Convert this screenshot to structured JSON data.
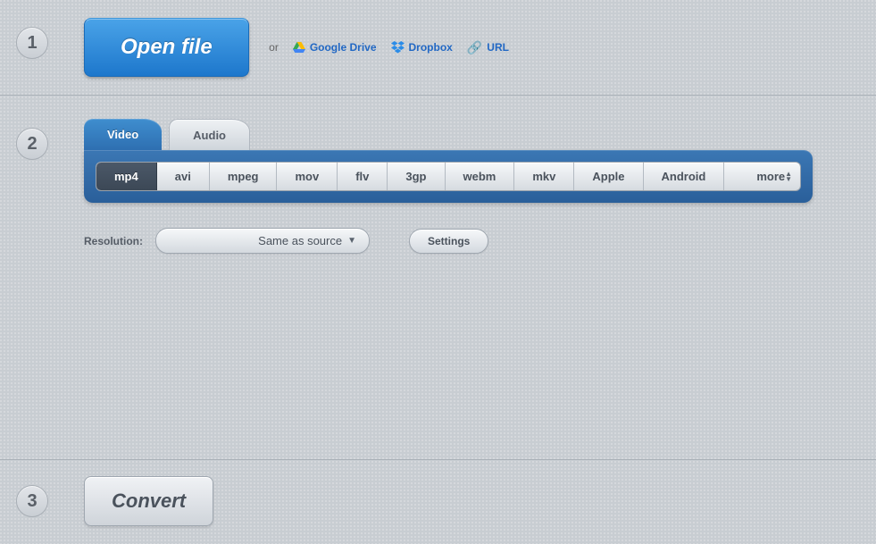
{
  "steps": {
    "one": "1",
    "two": "2",
    "three": "3"
  },
  "open_file": {
    "button_label": "Open file",
    "or_label": "or",
    "google_drive": "Google Drive",
    "dropbox": "Dropbox",
    "url": "URL"
  },
  "tabs": {
    "video": "Video",
    "audio": "Audio"
  },
  "formats": {
    "mp4": "mp4",
    "avi": "avi",
    "mpeg": "mpeg",
    "mov": "mov",
    "flv": "flv",
    "3gp": "3gp",
    "webm": "webm",
    "mkv": "mkv",
    "apple": "Apple",
    "android": "Android",
    "more": "more"
  },
  "options": {
    "resolution_label": "Resolution:",
    "resolution_value": "Same as source",
    "settings_label": "Settings"
  },
  "convert": {
    "label": "Convert"
  }
}
